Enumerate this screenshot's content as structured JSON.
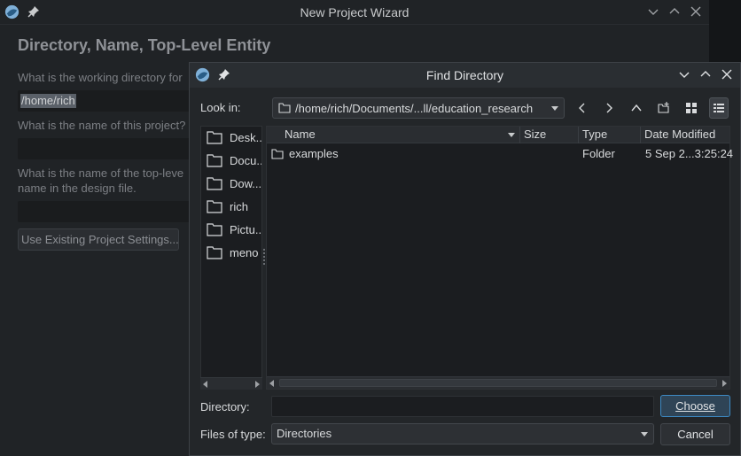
{
  "wizard": {
    "title": "New Project Wizard",
    "heading": "Directory, Name, Top-Level Entity",
    "q_directory": "What is the working directory for",
    "directory_value": "/home/rich",
    "q_name": "What is the name of this project?",
    "q_top_level_1": "What is the name of the top-leve",
    "q_top_level_2": "name in the design file.",
    "use_existing_label": "Use Existing Project Settings..."
  },
  "dialog": {
    "title": "Find Directory",
    "look_in_label": "Look in:",
    "path": "/home/rich/Documents/...ll/education_research",
    "toolbar_icons": [
      "back-arrow-icon",
      "forward-arrow-icon",
      "up-arrow-icon",
      "new-folder-icon",
      "list-view-icon",
      "detail-view-icon"
    ],
    "sidebar": [
      {
        "label": "Desk.."
      },
      {
        "label": "Docu.."
      },
      {
        "label": "Dow..."
      },
      {
        "label": "rich"
      },
      {
        "label": "Pictu.."
      },
      {
        "label": "meno"
      }
    ],
    "columns": [
      "Name",
      "Size",
      "Type",
      "Date Modified"
    ],
    "rows": [
      {
        "name": "examples",
        "size": "",
        "type": "Folder",
        "date": "5 Sep 2...3:25:24"
      }
    ],
    "directory_label": "Directory:",
    "directory_value": "",
    "files_of_type_label": "Files of type:",
    "files_of_type_value": "Directories",
    "choose_label": "Choose",
    "cancel_label": "Cancel"
  },
  "colors": {
    "accent": "#3d8ac4",
    "background": "#232629",
    "field": "#1b1d20"
  }
}
